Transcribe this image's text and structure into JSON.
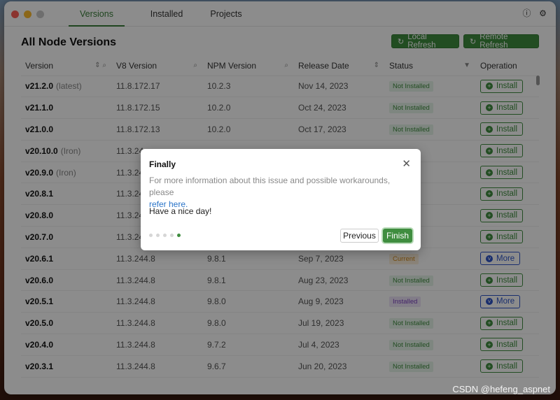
{
  "tabs": [
    "Versions",
    "Installed",
    "Projects"
  ],
  "title_icons": [
    "info-icon",
    "gear-icon"
  ],
  "page": {
    "title": "All Node Versions",
    "local_refresh": "Local Refresh",
    "remote_refresh": "Remote Refresh"
  },
  "columns": [
    "Version",
    "V8 Version",
    "NPM Version",
    "Release Date",
    "Status",
    "Operation"
  ],
  "rows": [
    {
      "version": "v21.2.0",
      "alias": "(latest)",
      "v8": "11.8.172.17",
      "npm": "10.2.3",
      "date": "Nov 14, 2023",
      "status": "Not Installed",
      "op": "Install"
    },
    {
      "version": "v21.1.0",
      "alias": "",
      "v8": "11.8.172.15",
      "npm": "10.2.0",
      "date": "Oct 24, 2023",
      "status": "Not Installed",
      "op": "Install"
    },
    {
      "version": "v21.0.0",
      "alias": "",
      "v8": "11.8.172.13",
      "npm": "10.2.0",
      "date": "Oct 17, 2023",
      "status": "Not Installed",
      "op": "Install"
    },
    {
      "version": "v20.10.0",
      "alias": "(Iron)",
      "v8": "11.3.24",
      "npm": "",
      "date": "",
      "status": "",
      "op": "Install"
    },
    {
      "version": "v20.9.0",
      "alias": "(Iron)",
      "v8": "11.3.24",
      "npm": "",
      "date": "",
      "status": "",
      "op": "Install"
    },
    {
      "version": "v20.8.1",
      "alias": "",
      "v8": "11.3.24",
      "npm": "",
      "date": "",
      "status": "",
      "op": "Install"
    },
    {
      "version": "v20.8.0",
      "alias": "",
      "v8": "11.3.24",
      "npm": "",
      "date": "",
      "status": "",
      "op": "Install"
    },
    {
      "version": "v20.7.0",
      "alias": "",
      "v8": "11.3.24",
      "npm": "",
      "date": "",
      "status": "",
      "op": "Install"
    },
    {
      "version": "v20.6.1",
      "alias": "",
      "v8": "11.3.244.8",
      "npm": "9.8.1",
      "date": "Sep 7, 2023",
      "status": "Current",
      "op": "More"
    },
    {
      "version": "v20.6.0",
      "alias": "",
      "v8": "11.3.244.8",
      "npm": "9.8.1",
      "date": "Aug 23, 2023",
      "status": "Not Installed",
      "op": "Install"
    },
    {
      "version": "v20.5.1",
      "alias": "",
      "v8": "11.3.244.8",
      "npm": "9.8.0",
      "date": "Aug 9, 2023",
      "status": "Installed",
      "op": "More"
    },
    {
      "version": "v20.5.0",
      "alias": "",
      "v8": "11.3.244.8",
      "npm": "9.8.0",
      "date": "Jul 19, 2023",
      "status": "Not Installed",
      "op": "Install"
    },
    {
      "version": "v20.4.0",
      "alias": "",
      "v8": "11.3.244.8",
      "npm": "9.7.2",
      "date": "Jul 4, 2023",
      "status": "Not Installed",
      "op": "Install"
    },
    {
      "version": "v20.3.1",
      "alias": "",
      "v8": "11.3.244.8",
      "npm": "9.6.7",
      "date": "Jun 20, 2023",
      "status": "Not Installed",
      "op": "Install"
    }
  ],
  "dialog": {
    "title": "Finally",
    "text": "For more information about this issue and possible workarounds, please",
    "link": "refer here.",
    "extra": "Have a nice day!",
    "previous": "Previous",
    "finish": "Finish",
    "steps_total": 5,
    "step_current": 5
  },
  "watermark": "CSDN @hefeng_aspnet",
  "colors": {
    "accent": "#3f8d3f",
    "more": "#2e55c8",
    "current": "#d48a1c",
    "installed": "#7a3fc0"
  }
}
